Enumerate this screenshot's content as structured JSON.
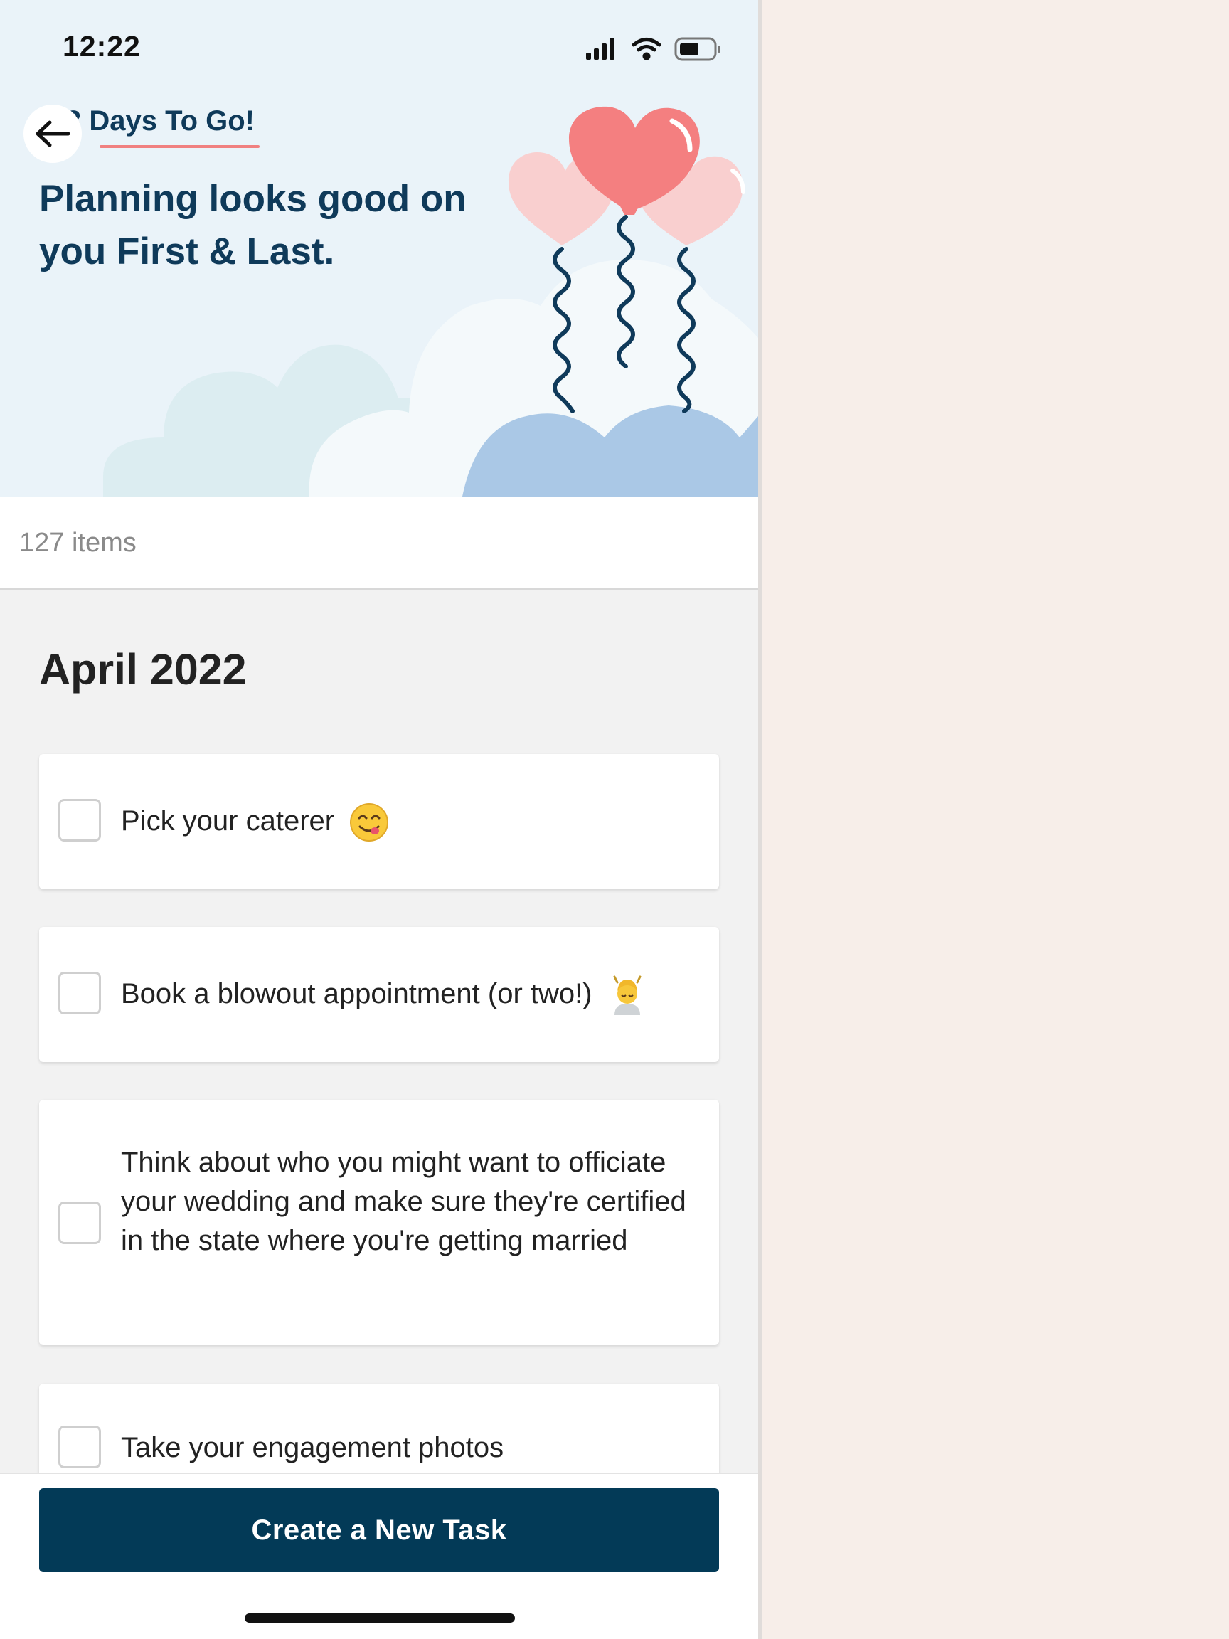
{
  "status_bar": {
    "time": "12:22"
  },
  "header": {
    "countdown": "3 Days To Go!",
    "headline": "Planning looks good on you First & Last."
  },
  "list": {
    "count": "127 items",
    "section": "April 2022",
    "tasks": [
      {
        "label": "Pick your caterer",
        "emoji": "yum-face-icon"
      },
      {
        "label": "Book a blowout appointment (or two!)",
        "emoji": "haircut-person-icon"
      },
      {
        "label": "Think about who you might want to officiate your wedding and make sure they're certified in the state where you're getting married"
      },
      {
        "label": "Take your engagement photos"
      }
    ]
  },
  "footer": {
    "cta_label": "Create a New Task"
  },
  "colors": {
    "navy": "#033a57",
    "accent_pink": "#f08080",
    "hero_bg": "#eaf3f9"
  }
}
